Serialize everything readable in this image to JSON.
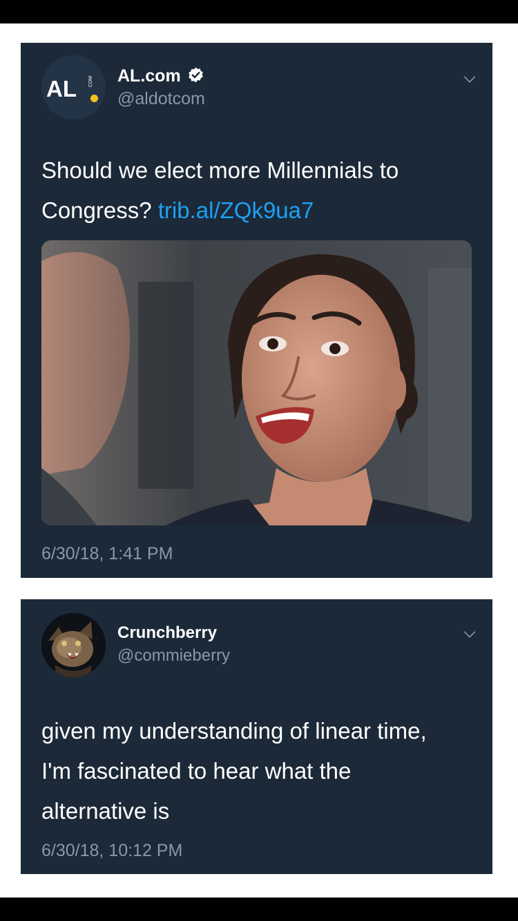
{
  "tweets": [
    {
      "name": "AL.com",
      "handle": "@aldotcom",
      "avatar_text": "AL",
      "avatar_small_text": "COM",
      "verified": true,
      "text": "Should we elect more Millennials to Congress?",
      "link": "trib.al/ZQk9ua7",
      "timestamp": "6/30/18, 1:41 PM",
      "has_media": true
    },
    {
      "name": "Crunchberry",
      "handle": "@commieberry",
      "verified": false,
      "text_lines": [
        "given my understanding of linear time,",
        "I'm fascinated to hear what the",
        "alternative is"
      ],
      "timestamp": "6/30/18, 10:12 PM",
      "has_media": false
    }
  ],
  "icons": {
    "verified": "verified-badge-icon",
    "more": "chevron-down-icon"
  },
  "colors": {
    "card_background": "#1c2938",
    "link": "#1da1f2",
    "secondary_text": "#8899a6",
    "logo_dot": "#f4c21b"
  }
}
